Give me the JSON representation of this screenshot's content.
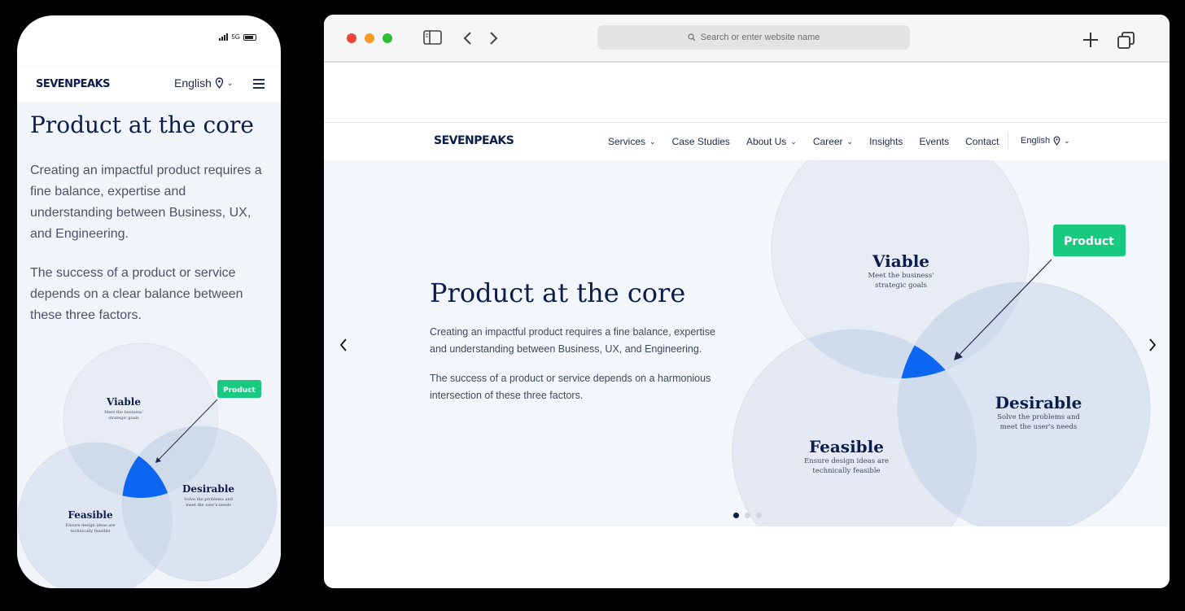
{
  "phone": {
    "network": "5G",
    "logo": "SEVENPEAKS",
    "language": "English",
    "title": "Product at the core",
    "para1": "Creating an impactful product requires a fine balance, expertise and understanding between Business, UX, and Engineering.",
    "para2": "The success of a product or service depends on a clear balance between these three factors."
  },
  "browser": {
    "search_placeholder": "Search or enter website name",
    "nav": {
      "logo": "SEVENPEAKS",
      "items": [
        "Services",
        "Case Studies",
        "About Us",
        "Career",
        "Insights",
        "Events",
        "Contact"
      ],
      "language": "English"
    },
    "hero": {
      "title": "Product at the core",
      "para1": "Creating an impactful product requires a fine balance, expertise and understanding between Business, UX, and Engineering.",
      "para2": "The success of a product or service depends on a harmonious intersection of these three factors.",
      "slide_count": 3,
      "active_slide": 1
    }
  },
  "diagram": {
    "product_label": "Product",
    "viable_title": "Viable",
    "viable_desc1": "Meet the business'",
    "viable_desc2": "strategic goals",
    "desirable_title": "Desirable",
    "desirable_desc1": "Solve the problems and",
    "desirable_desc2": "meet the user's needs",
    "feasible_title": "Feasible",
    "feasible_desc1": "Ensure design ideas are",
    "feasible_desc2": "technically feasible"
  },
  "colors": {
    "navy": "#0b1d4a",
    "product_green": "#19c97f",
    "core_blue": "#0060f0",
    "circle_fill": "#d9e3f1"
  }
}
